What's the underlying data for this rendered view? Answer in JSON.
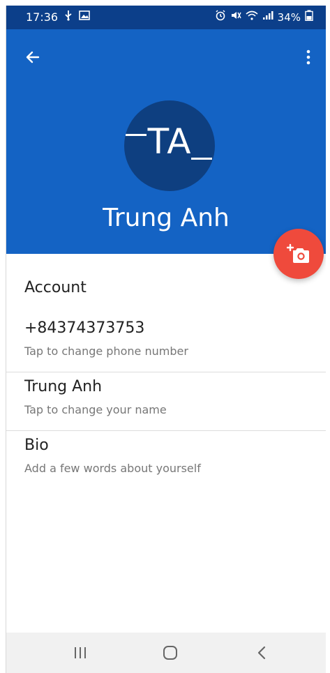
{
  "status_bar": {
    "time": "17:36",
    "battery": "34%",
    "icons_left": [
      "usb-icon",
      "image-icon"
    ],
    "icons_right": [
      "alarm-icon",
      "mute-icon",
      "wifi-icon",
      "signal-icon",
      "battery-icon"
    ]
  },
  "header": {
    "avatar_initials": "TA",
    "name": "Trung Anh",
    "colors": {
      "status_bar": "#0c3f8a",
      "header": "#1463c4",
      "avatar": "#0e3f80",
      "fab": "#ef4a3c"
    }
  },
  "content": {
    "section_title": "Account",
    "rows": [
      {
        "primary": "+84374373753",
        "secondary": "Tap to change phone number"
      },
      {
        "primary": "Trung Anh",
        "secondary": "Tap to change your name"
      },
      {
        "primary": "Bio",
        "secondary": "Add a few words about yourself"
      }
    ]
  },
  "nav_bar": {
    "icons": [
      "recent-apps-icon",
      "home-icon",
      "back-icon"
    ]
  }
}
